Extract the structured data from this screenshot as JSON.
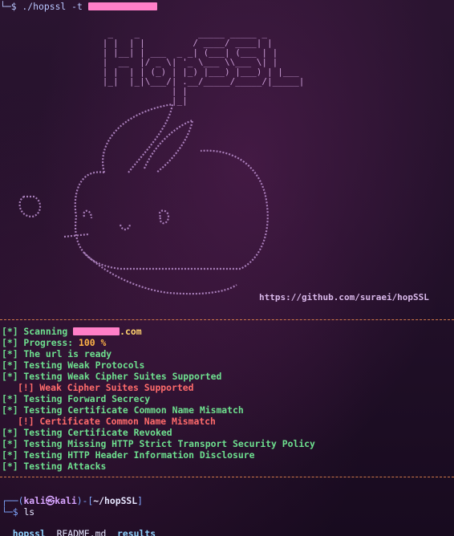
{
  "top_prompt": {
    "prefix": "└─$ ./hopssl -t ",
    "redacted_label": "[redacted]"
  },
  "banner": {
    "ascii_lines": [
      "       _    _           _____ _____ _ ",
      "      | |  | |         / ____/ ____| |",
      "      | |__| | ___  _ _| (___| (___ | |",
      "      |  __  |/ _ \\| '_ \\___ \\\\___ \\| |",
      "      | |  | | (_) | |_) |___) |___) | |___",
      "      |_|  |_|\\___/| .__/_____/_____/|_____|",
      "                   | |",
      "                   |_|"
    ],
    "github_url": "https://github.com/suraei/hopSSL"
  },
  "scan": {
    "target_suffix": ".com",
    "progress_label": "[*] Progress: ",
    "progress_value": "100 %",
    "lines": [
      {
        "kind": "ok",
        "text": "[*] Scanning "
      },
      {
        "kind": "ok",
        "text": "[*] The url is ready"
      },
      {
        "kind": "ok",
        "text": "[*] Testing Weak Protocols"
      },
      {
        "kind": "ok",
        "text": "[*] Testing Weak Cipher Suites Supported"
      },
      {
        "kind": "warn",
        "text": "[!] Weak Cipher Suites Supported"
      },
      {
        "kind": "ok",
        "text": "[*] Testing Forward Secrecy"
      },
      {
        "kind": "ok",
        "text": "[*] Testing Certificate Common Name Mismatch"
      },
      {
        "kind": "warn",
        "text": "[!] Certificate Common Name Mismatch"
      },
      {
        "kind": "ok",
        "text": "[*] Testing Certificate Revoked"
      },
      {
        "kind": "ok",
        "text": "[*] Testing Missing HTTP Strict Transport Security Policy"
      },
      {
        "kind": "ok",
        "text": "[*] Testing HTTP Header Information Disclosure"
      },
      {
        "kind": "ok",
        "text": "[*] Testing Attacks"
      }
    ]
  },
  "footer": {
    "prompt_open": "┌──(",
    "user": "kali㉿kali",
    "prompt_mid": ")-[",
    "path": "~/hopSSL",
    "prompt_close": "]",
    "cmd_prefix": "└─$ ",
    "cmd": "ls",
    "files": [
      "hopssl",
      "README.md",
      "results"
    ]
  },
  "colors": {
    "ok": "#6ee08f",
    "warn": "#ff6b6b",
    "progress": "#ffb347",
    "redact": "#ff7fc8",
    "separator": "#d47a4a"
  }
}
